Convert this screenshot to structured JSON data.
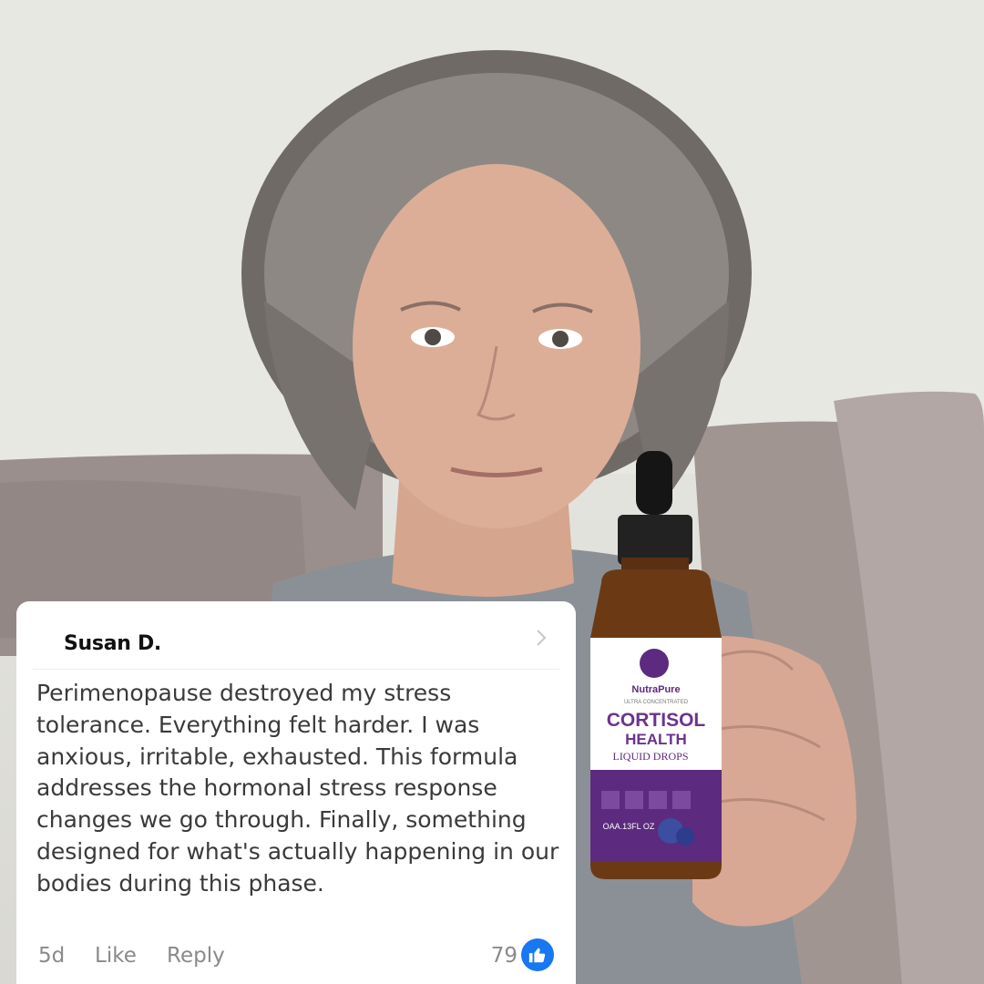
{
  "comment": {
    "author": "Susan D.",
    "text": "Perimenopause destroyed my stress tolerance. Everything felt harder. I was anxious, irritable, exhausted. This formula addresses the hormonal stress response changes we go through. Finally, something designed for what's actually happening in our bodies during this phase.",
    "timestamp": "5d",
    "like_label": "Like",
    "reply_label": "Reply",
    "reaction_count": "79",
    "reaction_icon": "thumbs-up-icon",
    "reaction_color": "#1877f2"
  },
  "product": {
    "brand": "NutraPure",
    "tagline": "ULTRA CONCENTRATED",
    "name_line1": "CORTISOL",
    "name_line2": "HEALTH",
    "form": "LIQUID DROPS",
    "volume": "OAA.13FL OZ",
    "label_color": "#5c2a7e"
  }
}
